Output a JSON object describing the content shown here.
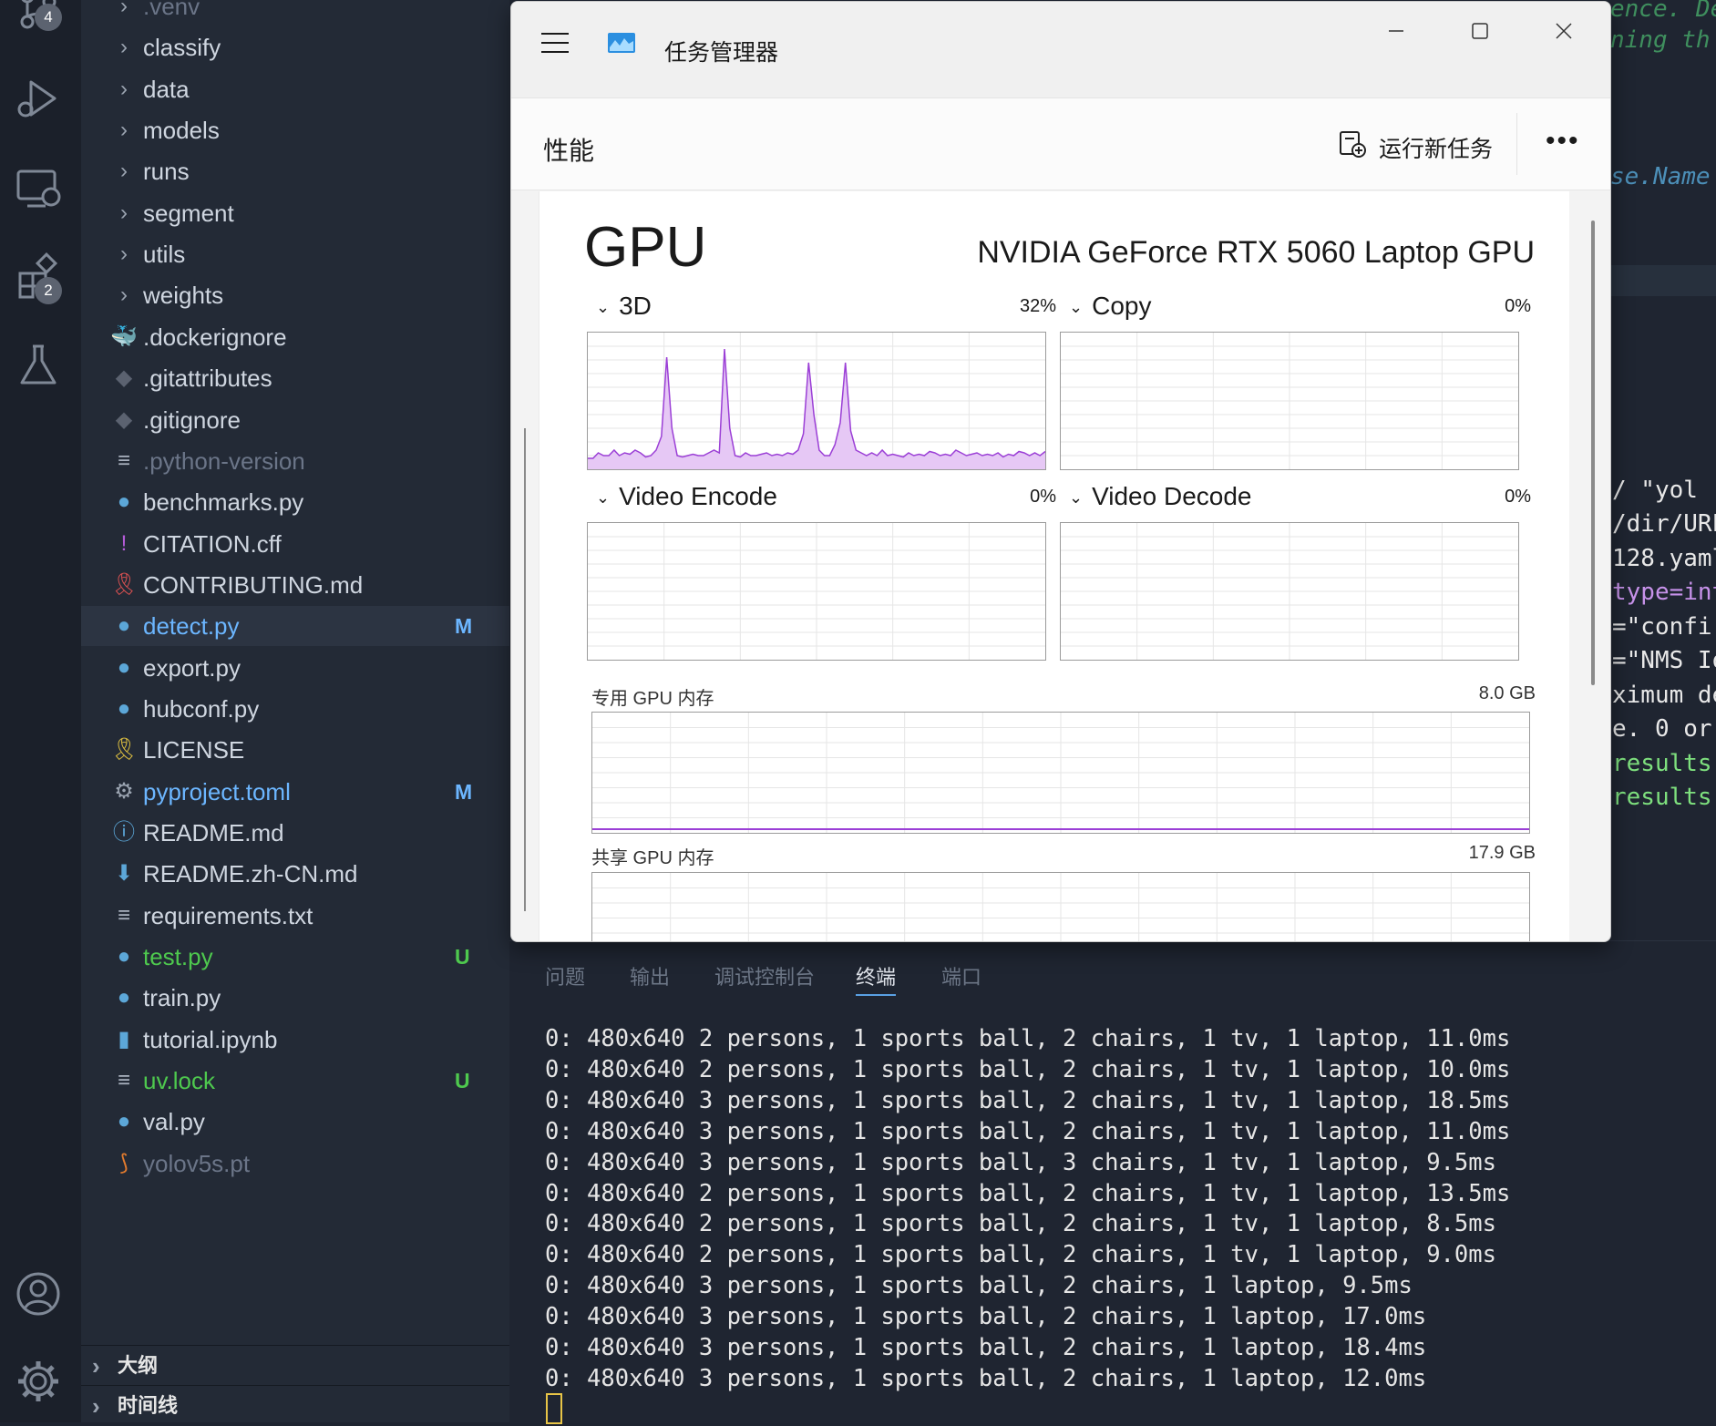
{
  "activity_bar": {
    "source_control_badge": "4",
    "extensions_badge": "2"
  },
  "explorer": {
    "items": [
      {
        "label": ".venv",
        "type": "folder",
        "color": "#6b7588"
      },
      {
        "label": "classify",
        "type": "folder"
      },
      {
        "label": "data",
        "type": "folder"
      },
      {
        "label": "models",
        "type": "folder"
      },
      {
        "label": "runs",
        "type": "folder"
      },
      {
        "label": "segment",
        "type": "folder"
      },
      {
        "label": "utils",
        "type": "folder"
      },
      {
        "label": "weights",
        "type": "folder"
      },
      {
        "label": ".dockerignore",
        "type": "docker"
      },
      {
        "label": ".gitattributes",
        "type": "git"
      },
      {
        "label": ".gitignore",
        "type": "git"
      },
      {
        "label": ".python-version",
        "type": "text",
        "color": "#6b7588"
      },
      {
        "label": "benchmarks.py",
        "type": "python"
      },
      {
        "label": "CITATION.cff",
        "type": "exclaim"
      },
      {
        "label": "CONTRIBUTING.md",
        "type": "ribbon"
      },
      {
        "label": "detect.py",
        "type": "python",
        "status": "M",
        "color": "#6cb6ff",
        "selected": true
      },
      {
        "label": "export.py",
        "type": "python"
      },
      {
        "label": "hubconf.py",
        "type": "python"
      },
      {
        "label": "LICENSE",
        "type": "license"
      },
      {
        "label": "pyproject.toml",
        "type": "gear",
        "status": "M",
        "color": "#6cb6ff"
      },
      {
        "label": "README.md",
        "type": "info"
      },
      {
        "label": "README.zh-CN.md",
        "type": "download"
      },
      {
        "label": "requirements.txt",
        "type": "text"
      },
      {
        "label": "test.py",
        "type": "python",
        "status": "U",
        "color": "#4ec94e"
      },
      {
        "label": "train.py",
        "type": "python"
      },
      {
        "label": "tutorial.ipynb",
        "type": "notebook"
      },
      {
        "label": "uv.lock",
        "type": "text",
        "status": "U",
        "color": "#4ec94e"
      },
      {
        "label": "val.py",
        "type": "python"
      },
      {
        "label": "yolov5s.pt",
        "type": "rss",
        "color": "#6b7588"
      }
    ],
    "sections": [
      "大纲",
      "时间线"
    ]
  },
  "editor_fragments": [
    {
      "text": "ence. De",
      "color": "#3f8f5e",
      "italic": true
    },
    {
      "text": "ning th",
      "color": "#3f8f5e",
      "italic": true
    },
    {
      "text": "se.Name",
      "color": "#4c8fb8",
      "italic": true
    },
    {
      "text": "/ \"yol",
      "color": "#e8e8e8"
    },
    {
      "text": "/dir/URL",
      "color": "#e8e8e8"
    },
    {
      "text": "128.yaml",
      "color": "#e8e8e8"
    },
    {
      "text": "type=int",
      "color": "#c792ea"
    },
    {
      "text": "=\"confi",
      "color": "#e8e8e8"
    },
    {
      "text": "=\"NMS Io",
      "color": "#e8e8e8"
    },
    {
      "text": "ximum de",
      "color": "#e8e8e8"
    },
    {
      "text": "e. 0 or",
      "color": "#e8e8e8"
    },
    {
      "text": "results",
      "color": "#7ee07e"
    },
    {
      "text": "results",
      "color": "#7ee07e"
    }
  ],
  "panel": {
    "tabs": [
      "问题",
      "输出",
      "调试控制台",
      "终端",
      "端口"
    ],
    "active_tab": "终端",
    "terminal_lines": [
      "0: 480x640 2 persons, 1 sports ball, 2 chairs, 1 tv, 1 laptop, 11.0ms",
      "0: 480x640 2 persons, 1 sports ball, 2 chairs, 1 tv, 1 laptop, 10.0ms",
      "0: 480x640 3 persons, 1 sports ball, 2 chairs, 1 tv, 1 laptop, 18.5ms",
      "0: 480x640 3 persons, 1 sports ball, 2 chairs, 1 tv, 1 laptop, 11.0ms",
      "0: 480x640 3 persons, 1 sports ball, 3 chairs, 1 tv, 1 laptop, 9.5ms",
      "0: 480x640 2 persons, 1 sports ball, 2 chairs, 1 tv, 1 laptop, 13.5ms",
      "0: 480x640 2 persons, 1 sports ball, 2 chairs, 1 tv, 1 laptop, 8.5ms",
      "0: 480x640 2 persons, 1 sports ball, 2 chairs, 1 tv, 1 laptop, 9.0ms",
      "0: 480x640 3 persons, 1 sports ball, 2 chairs, 1 laptop, 9.5ms",
      "0: 480x640 3 persons, 1 sports ball, 2 chairs, 1 laptop, 17.0ms",
      "0: 480x640 3 persons, 1 sports ball, 2 chairs, 1 laptop, 18.4ms",
      "0: 480x640 3 persons, 1 sports ball, 2 chairs, 1 laptop, 12.0ms"
    ]
  },
  "task_manager": {
    "title": "任务管理器",
    "page": "性能",
    "run_new_task": "运行新任务",
    "more": "•••",
    "gpu_heading": "GPU",
    "gpu_model": "NVIDIA GeForce RTX 5060 Laptop GPU",
    "engines": [
      {
        "name": "3D",
        "percent": "32%",
        "util": [
          8,
          8,
          12,
          10,
          10,
          14,
          10,
          12,
          11,
          14,
          12,
          9,
          10,
          14,
          24,
          82,
          30,
          10,
          9,
          10,
          11,
          10,
          10,
          12,
          14,
          12,
          88,
          30,
          10,
          9,
          12,
          10,
          10,
          11,
          12,
          10,
          11,
          10,
          12,
          11,
          14,
          26,
          78,
          40,
          14,
          10,
          10,
          18,
          34,
          78,
          28,
          14,
          12,
          10,
          12,
          10,
          14,
          10,
          11,
          10,
          9,
          12,
          10,
          11,
          10,
          13,
          12,
          10,
          11,
          10,
          14,
          12,
          10,
          11,
          12,
          10,
          11,
          10,
          12,
          9,
          11,
          10,
          13,
          12,
          10,
          12,
          10,
          13
        ]
      },
      {
        "name": "Copy",
        "percent": "0%"
      },
      {
        "name": "Video Encode",
        "percent": "0%"
      },
      {
        "name": "Video Decode",
        "percent": "0%"
      }
    ],
    "dedicated_mem_label": "专用 GPU 内存",
    "dedicated_mem_total": "8.0 GB",
    "shared_mem_label": "共享 GPU 内存",
    "shared_mem_total": "17.9 GB",
    "accent": "#9b3fd6",
    "fill": "#e6c8f5"
  }
}
